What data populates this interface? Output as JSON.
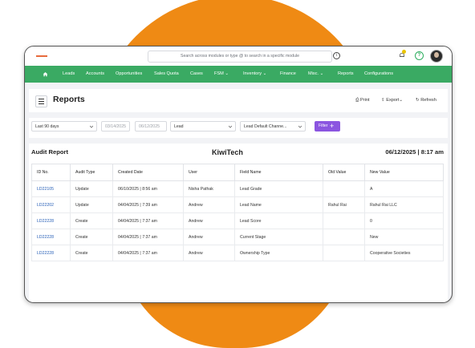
{
  "topbar": {
    "search_placeholder": "Search across modules or type @ to search in a specific module",
    "info_icon": "i",
    "help_icon": "?"
  },
  "nav": {
    "items": [
      "Leads",
      "Accounts",
      "Opportunities",
      "Sales Quota",
      "Cases",
      "FSM",
      "Inventory",
      "Finance",
      "Misc.",
      "Reports",
      "Configurations"
    ]
  },
  "page": {
    "title": "Reports",
    "print_label": "Print",
    "export_label": "Export",
    "refresh_label": "Refresh"
  },
  "filters": {
    "range": "Last 90 days",
    "start_date": "03/14/2025",
    "end_date": "06/12/2025",
    "module": "Lead",
    "channel": "Lead Default Channe...",
    "filter_button": "Filter",
    "filter_plus": "+"
  },
  "report": {
    "title": "Audit Report",
    "company": "KiwiTech",
    "generated": "06/12/2025 | 8:17 am",
    "columns": [
      "ID No.",
      "Audit Type",
      "Created Date",
      "User",
      "Field Name",
      "Old Value",
      "New Value"
    ],
    "rows": [
      [
        "LD22105",
        "Update",
        "06/10/2025 | 8:56 am",
        "Nisha Pathak",
        "Lead Grade",
        "",
        "A"
      ],
      [
        "LD22202",
        "Update",
        "04/04/2025 | 7:39 am",
        "Andrew",
        "Lead Name",
        "Rahul Rai",
        "Rahul Rai LLC"
      ],
      [
        "LD22228",
        "Create",
        "04/04/2025 | 7:37 am",
        "Andrew",
        "Lead Score",
        "",
        "0"
      ],
      [
        "LD22228",
        "Create",
        "04/04/2025 | 7:37 am",
        "Andrew",
        "Current Stage",
        "",
        "New"
      ],
      [
        "LD22228",
        "Create",
        "04/04/2025 | 7:37 am",
        "Andrew",
        "Ownership Type",
        "",
        "Cooperative Societies"
      ]
    ]
  },
  "colors": {
    "accent_orange": "#ef8a14",
    "nav_green": "#3aaa63",
    "filter_purple": "#8b55e0",
    "link_blue": "#2a62b8"
  }
}
